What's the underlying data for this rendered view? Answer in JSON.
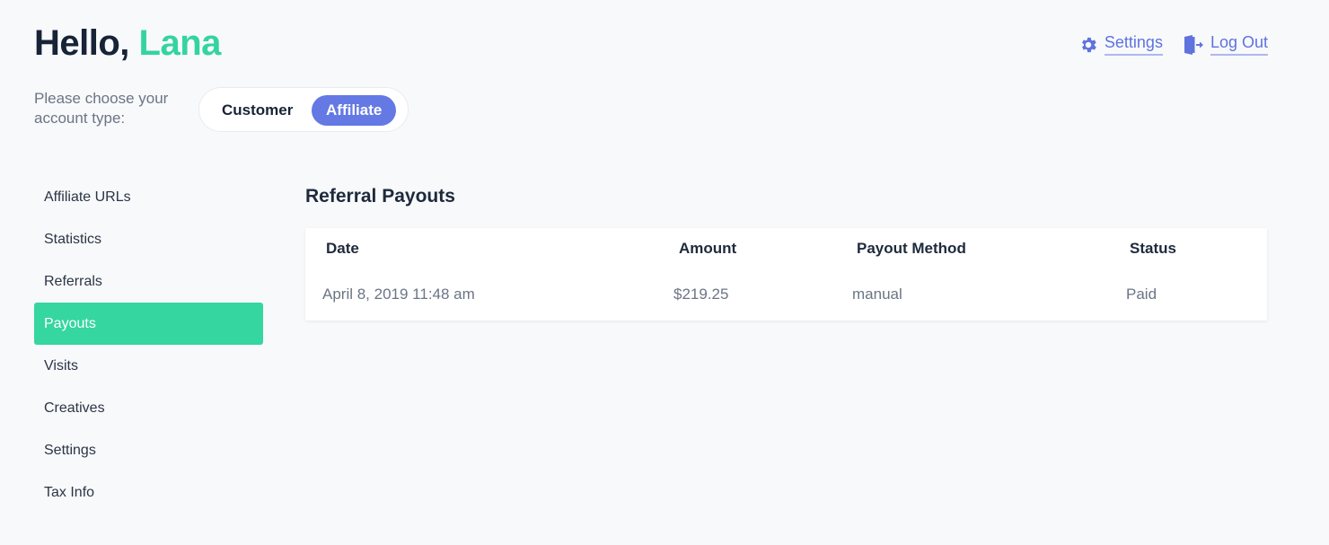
{
  "header": {
    "greeting_prefix": "Hello,",
    "user_name": "Lana",
    "account_type_label": "Please choose your account type:",
    "account_types": [
      {
        "label": "Customer",
        "selected": false
      },
      {
        "label": "Affiliate",
        "selected": true
      }
    ],
    "links": [
      {
        "label": "Settings",
        "icon": "gear-icon"
      },
      {
        "label": "Log Out",
        "icon": "logout-door-icon"
      }
    ]
  },
  "sidebar": {
    "items": [
      {
        "label": "Affiliate URLs",
        "active": false
      },
      {
        "label": "Statistics",
        "active": false
      },
      {
        "label": "Referrals",
        "active": false
      },
      {
        "label": "Payouts",
        "active": true
      },
      {
        "label": "Visits",
        "active": false
      },
      {
        "label": "Creatives",
        "active": false
      },
      {
        "label": "Settings",
        "active": false
      },
      {
        "label": "Tax Info",
        "active": false
      }
    ]
  },
  "main": {
    "title": "Referral Payouts",
    "table": {
      "columns": [
        "Date",
        "Amount",
        "Payout Method",
        "Status"
      ],
      "rows": [
        [
          "April 8, 2019 11:48 am",
          "$219.25",
          "manual",
          "Paid"
        ]
      ]
    }
  },
  "colors": {
    "accent_green": "#34d49e",
    "accent_blue": "#6479e3",
    "link_blue": "#5f73de"
  }
}
